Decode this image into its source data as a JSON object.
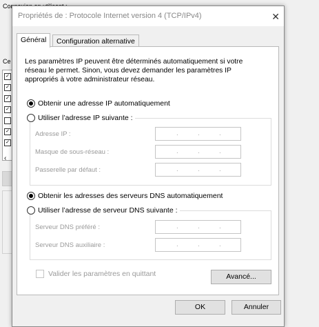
{
  "background": {
    "top_text": "Connexion en utilisant :",
    "side_label": "Ce"
  },
  "dialog": {
    "title": "Propriétés de : Protocole Internet version 4 (TCP/IPv4)",
    "close_glyph": "✕",
    "tabs": [
      {
        "label": "Général"
      },
      {
        "label": "Configuration alternative"
      }
    ],
    "intro_lines": [
      "Les paramètres IP peuvent être déterminés automatiquement si votre",
      "réseau le permet. Sinon, vous devez demander les paramètres IP",
      "appropriés à votre administrateur réseau."
    ],
    "ip_auto_label": "Obtenir une adresse IP automatiquement",
    "ip_manual_label": "Utiliser l’adresse IP suivante :",
    "ip_fields": [
      {
        "label": "Adresse IP :",
        "value": ". . ."
      },
      {
        "label": "Masque de sous-réseau :",
        "value": ". . ."
      },
      {
        "label": "Passerelle par défaut :",
        "value": ". . ."
      }
    ],
    "dns_auto_label": "Obtenir les adresses des serveurs DNS automatiquement",
    "dns_manual_label": "Utiliser l’adresse de serveur DNS suivante :",
    "dns_fields": [
      {
        "label": "Serveur DNS préféré :",
        "value": ". . ."
      },
      {
        "label": "Serveur DNS auxiliaire :",
        "value": ". . ."
      }
    ],
    "validate_label": "Valider les paramètres en quittant",
    "advanced_label": "Avancé...",
    "ok_label": "OK",
    "cancel_label": "Annuler",
    "selected_ip_option": "automatic",
    "selected_dns_option": "automatic"
  }
}
